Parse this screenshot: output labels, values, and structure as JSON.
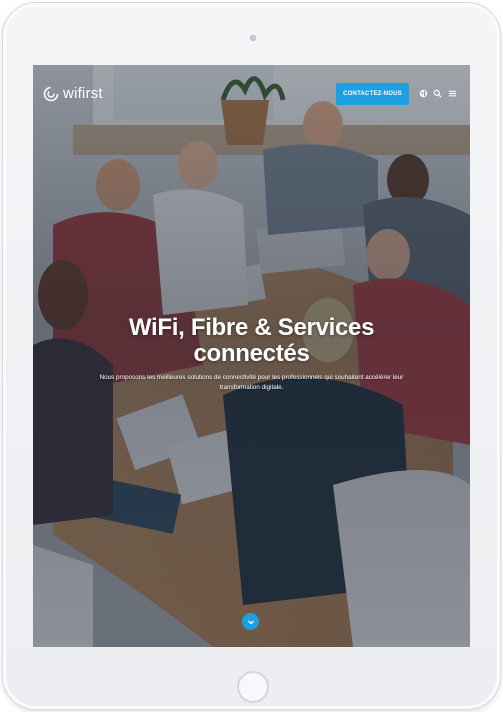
{
  "brand": {
    "name": "wifirst"
  },
  "navbar": {
    "contact_label": "CONTACTEZ-NOUS",
    "icons": [
      "globe-icon",
      "search-icon",
      "menu-icon"
    ]
  },
  "hero": {
    "title_line1": "WiFi, Fibre & Services",
    "title_line2": "connectés",
    "subtitle": "Nous proposons les meilleures solutions de connectivité pour les professionnels qui souhaitent accélérer leur transformation digitale."
  },
  "colors": {
    "accent": "#1ea0e0",
    "text": "#ffffff"
  }
}
